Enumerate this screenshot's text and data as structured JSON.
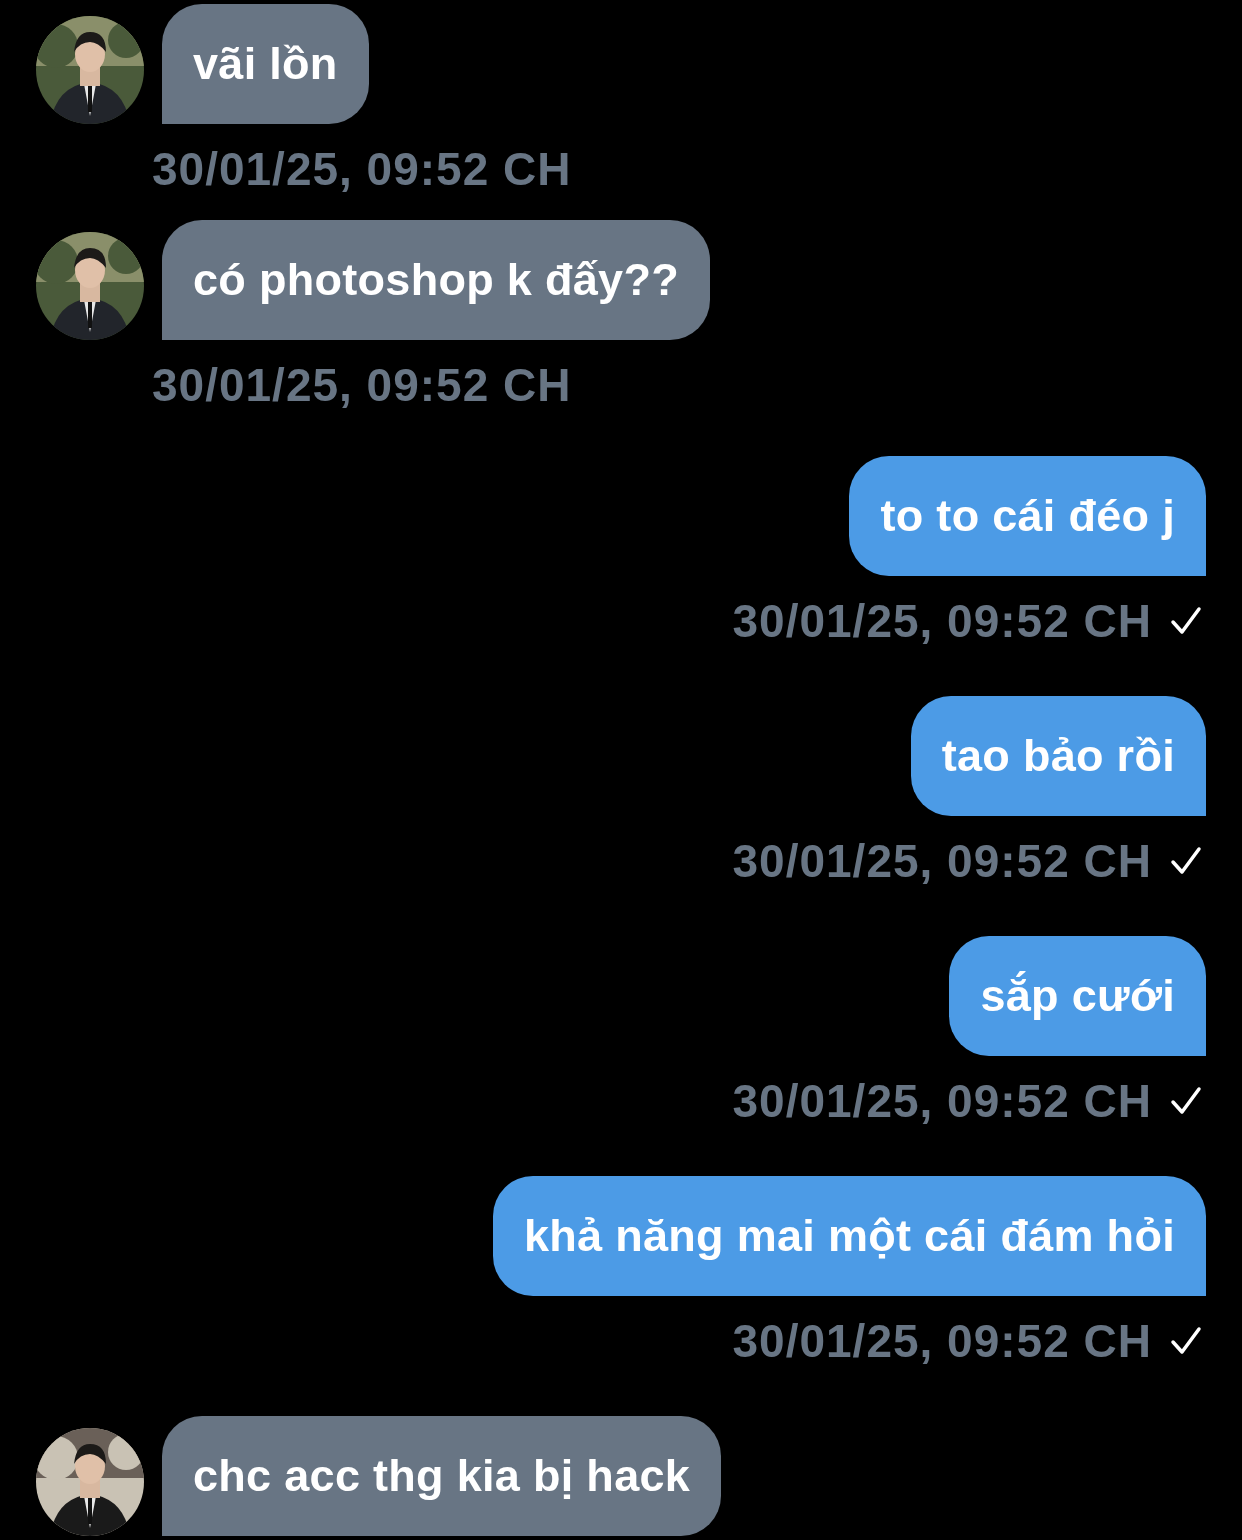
{
  "messages": [
    {
      "kind": "incoming",
      "text": "vãi lồn",
      "time": "30/01/25, 09:52 CH"
    },
    {
      "kind": "incoming",
      "text": "có photoshop k đấy??",
      "time": "30/01/25, 09:52 CH"
    },
    {
      "kind": "outgoing",
      "text": "to to cái đéo j",
      "time": "30/01/25, 09:52 CH",
      "delivered": true
    },
    {
      "kind": "outgoing",
      "text": "tao bảo rồi",
      "time": "30/01/25, 09:52 CH",
      "delivered": true
    },
    {
      "kind": "outgoing",
      "text": "sắp cưới",
      "time": "30/01/25, 09:52 CH",
      "delivered": true
    },
    {
      "kind": "outgoing",
      "text": "khả năng mai một cái đám hỏi",
      "time": "30/01/25, 09:52 CH",
      "delivered": true
    },
    {
      "kind": "incoming",
      "text": "chc acc thg kia bị hack"
    }
  ]
}
